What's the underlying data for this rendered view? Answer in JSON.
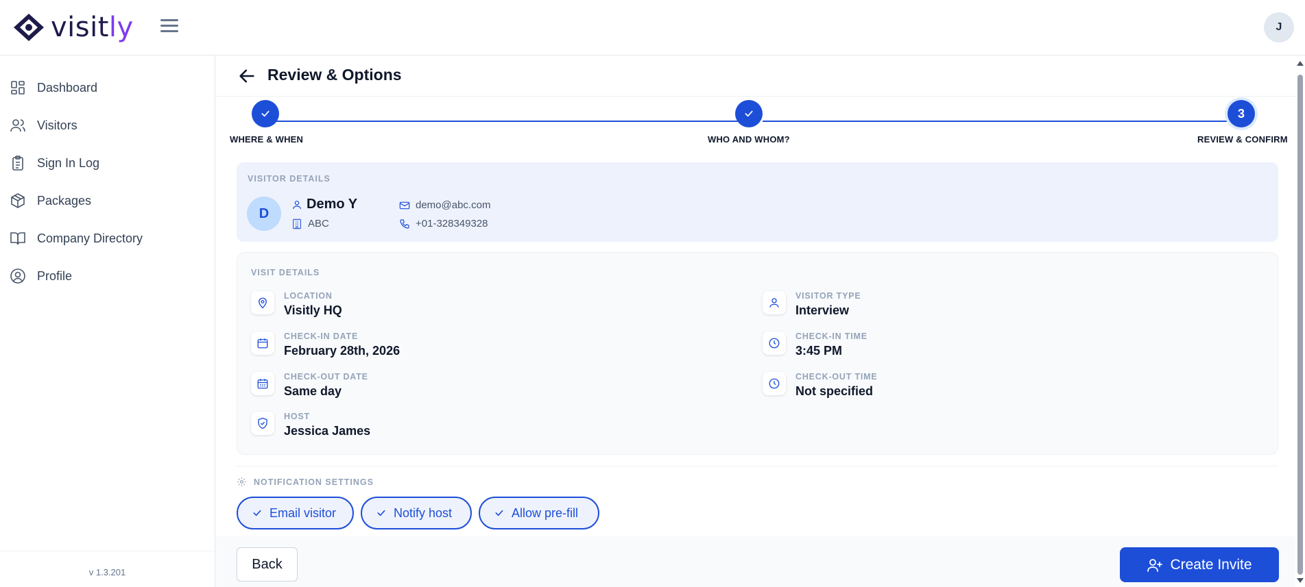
{
  "app": {
    "brand": {
      "name_main": "visit",
      "name_accent": "ly"
    },
    "user_initial": "J",
    "accent_color": "#1d4ed8"
  },
  "sidebar": {
    "items": [
      {
        "label": "Dashboard",
        "icon": "dashboard-icon"
      },
      {
        "label": "Visitors",
        "icon": "users-icon"
      },
      {
        "label": "Sign In Log",
        "icon": "clipboard-icon"
      },
      {
        "label": "Packages",
        "icon": "package-icon"
      },
      {
        "label": "Company Directory",
        "icon": "book-icon"
      },
      {
        "label": "Profile",
        "icon": "user-circle-icon"
      }
    ],
    "version": "v 1.3.201"
  },
  "page": {
    "title": "Review & Options"
  },
  "stepper": {
    "steps": [
      {
        "label": "WHERE & WHEN",
        "state": "done"
      },
      {
        "label": "WHO AND WHOM?",
        "state": "done"
      },
      {
        "label": "REVIEW & CONFIRM",
        "state": "current",
        "number": "3"
      }
    ]
  },
  "visitor": {
    "section_label": "VISITOR DETAILS",
    "initial": "D",
    "name": "Demo Y",
    "company": "ABC",
    "email": "demo@abc.com",
    "phone": "+01-328349328"
  },
  "visit": {
    "section_label": "VISIT DETAILS",
    "location": {
      "label": "LOCATION",
      "value": "Visitly HQ"
    },
    "visitor_type": {
      "label": "VISITOR TYPE",
      "value": "Interview"
    },
    "checkin_date": {
      "label": "CHECK-IN DATE",
      "value": "February 28th, 2026"
    },
    "checkin_time": {
      "label": "CHECK-IN TIME",
      "value": "3:45 PM"
    },
    "checkout_date": {
      "label": "CHECK-OUT DATE",
      "value": "Same day"
    },
    "checkout_time": {
      "label": "CHECK-OUT TIME",
      "value": "Not specified"
    },
    "host": {
      "label": "HOST",
      "value": "Jessica James"
    }
  },
  "notifications": {
    "section_label": "NOTIFICATION SETTINGS",
    "options": [
      {
        "label": "Email visitor",
        "checked": true
      },
      {
        "label": "Notify host",
        "checked": true
      },
      {
        "label": "Allow pre-fill",
        "checked": true
      }
    ]
  },
  "footer": {
    "back_label": "Back",
    "create_label": "Create Invite"
  }
}
